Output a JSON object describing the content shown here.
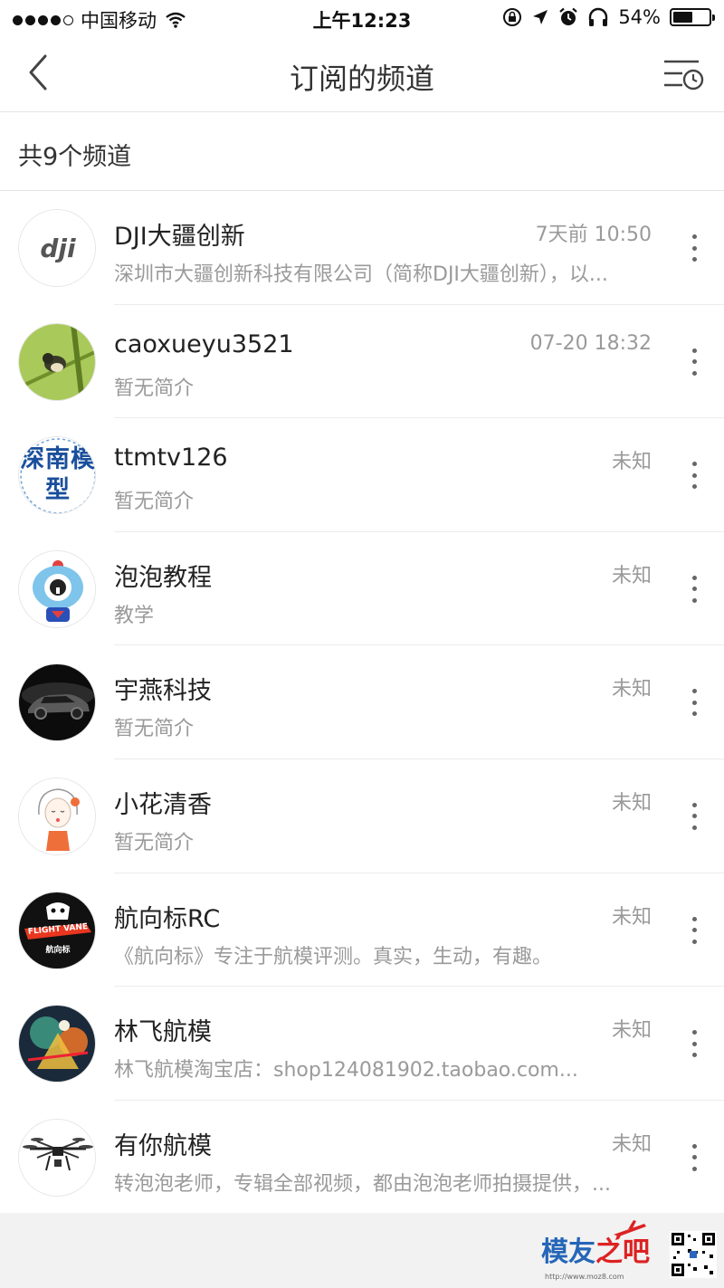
{
  "status_bar": {
    "carrier": "中国移动",
    "time": "上午12:23",
    "battery_percent_text": "54%",
    "battery_level": 0.54
  },
  "nav": {
    "title": "订阅的频道",
    "back_icon": "chevron-left-icon",
    "history_icon": "list-clock-icon"
  },
  "count": {
    "text": "共9个频道"
  },
  "channels": [
    {
      "name": "DJI大疆创新",
      "desc": "深圳市大疆创新科技有限公司（简称DJI大疆创新），以...",
      "time": "7天前 10:50"
    },
    {
      "name": "caoxueyu3521",
      "desc": "暂无简介",
      "time": "07-20 18:32"
    },
    {
      "name": "ttmtv126",
      "desc": "暂无简介",
      "time": "未知",
      "avatar_text": "深南模型"
    },
    {
      "name": "泡泡教程",
      "desc": "教学",
      "time": "未知"
    },
    {
      "name": "宇燕科技",
      "desc": "暂无简介",
      "time": "未知"
    },
    {
      "name": "小花清香",
      "desc": "暂无简介",
      "time": "未知"
    },
    {
      "name": "航向标RC",
      "desc": "《航向标》专注于航模评测。真实，生动，有趣。",
      "time": "未知",
      "avatar_text": "FLIGHT VANE"
    },
    {
      "name": "林飞航模",
      "desc": "林飞航模淘宝店：shop124081902.taobao.com...",
      "time": "未知"
    },
    {
      "name": "有你航模",
      "desc": "转泡泡老师，专辑全部视频，都由泡泡老师拍摄提供，...",
      "time": "未知"
    }
  ],
  "watermark": {
    "brand": "模友",
    "suffix": "之吧",
    "url": "http://www.moz8.com"
  },
  "colors": {
    "accent_blue": "#2566b8",
    "watermark_red": "#d22222",
    "meta_gray": "#9a9a9a"
  }
}
